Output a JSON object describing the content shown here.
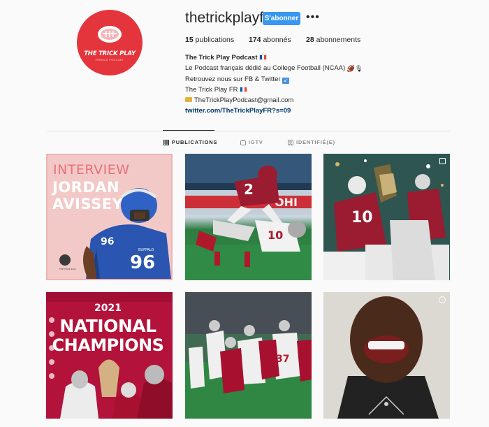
{
  "profile": {
    "username": "thetrickplayfr",
    "follow_label": "S'abonner",
    "more_label": "•••",
    "avatar_text": "THE TRICK PLAY",
    "avatar_subtext": "FRENCH PODCAST"
  },
  "stats": {
    "posts_count": "15",
    "posts_label": "publications",
    "followers_count": "174",
    "followers_label": "abonnés",
    "following_count": "28",
    "following_label": "abonnements"
  },
  "bio": {
    "name": "The Trick Play Podcast",
    "line1": "Le Podcast français dédié au College Football (NCAA)",
    "line2": "Retrouvez nous sur FB & Twitter",
    "line3": "The Trick Play FR",
    "email": "TheTrickPlayPodcast@gmail.com",
    "link": "twitter.com/TheTrickPlayFR?s=09"
  },
  "tabs": [
    {
      "label": "PUBLICATIONS",
      "icon": "grid-icon",
      "active": true
    },
    {
      "label": "IGTV",
      "icon": "igtv-icon",
      "active": false
    },
    {
      "label": "IDENTIFIÉ(E)",
      "icon": "tagged-icon",
      "active": false
    }
  ],
  "posts": {
    "p1": {
      "line1": "INTERVIEW",
      "line2": "JORDAN",
      "line3": "AVISSEY",
      "jersey": "96",
      "team": "BUFFALO"
    },
    "p2": {
      "jersey_a": "2",
      "jersey_b": "10"
    },
    "p3": {
      "jersey": "10"
    },
    "p4": {
      "year": "2021",
      "line1": "NATIONAL",
      "line2": "CHAMPIONS"
    },
    "p5": {
      "jersey": "37"
    }
  },
  "colors": {
    "accent_blue": "#3897f0",
    "avatar_red": "#e5353c",
    "alabama_crimson": "#b5123a"
  }
}
